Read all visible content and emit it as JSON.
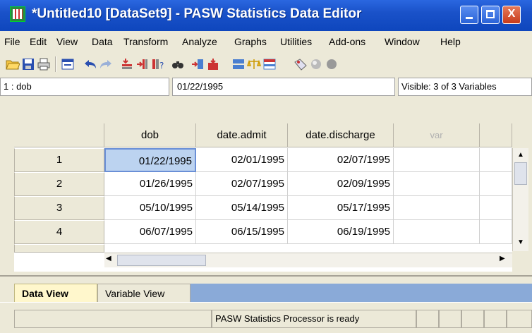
{
  "window": {
    "title": "*Untitled10 [DataSet9] - PASW Statistics Data Editor",
    "min_label": "_",
    "close_label": "X"
  },
  "menu": [
    "File",
    "Edit",
    "View",
    "Data",
    "Transform",
    "Analyze",
    "Graphs",
    "Utilities",
    "Add-ons",
    "Window",
    "Help"
  ],
  "toolbar_icons": [
    "open-icon",
    "save-icon",
    "print-icon",
    "dialog-recall-icon",
    "undo-icon",
    "redo-icon",
    "goto-case-icon",
    "goto-variable-icon",
    "variables-icon",
    "find-icon",
    "insert-cases-icon",
    "insert-variable-icon",
    "split-file-icon",
    "weight-cases-icon",
    "select-cases-icon",
    "value-labels-icon",
    "use-variable-sets-icon",
    "show-all-variables-icon"
  ],
  "editor": {
    "cell_ref": "1 : dob",
    "cell_value": "01/22/1995",
    "visible": "Visible: 3 of 3 Variables"
  },
  "grid": {
    "columns": [
      "dob",
      "date.admit",
      "date.discharge",
      "var"
    ],
    "rows": [
      {
        "num": "1",
        "cells": [
          "01/22/1995",
          "02/01/1995",
          "02/07/1995"
        ]
      },
      {
        "num": "2",
        "cells": [
          "01/26/1995",
          "02/07/1995",
          "02/09/1995"
        ]
      },
      {
        "num": "3",
        "cells": [
          "05/10/1995",
          "05/14/1995",
          "05/17/1995"
        ]
      },
      {
        "num": "4",
        "cells": [
          "06/07/1995",
          "06/15/1995",
          "06/19/1995"
        ]
      }
    ]
  },
  "tabs": {
    "data_view": "Data View",
    "variable_view": "Variable View"
  },
  "status": {
    "text": "PASW Statistics  Processor is ready"
  }
}
